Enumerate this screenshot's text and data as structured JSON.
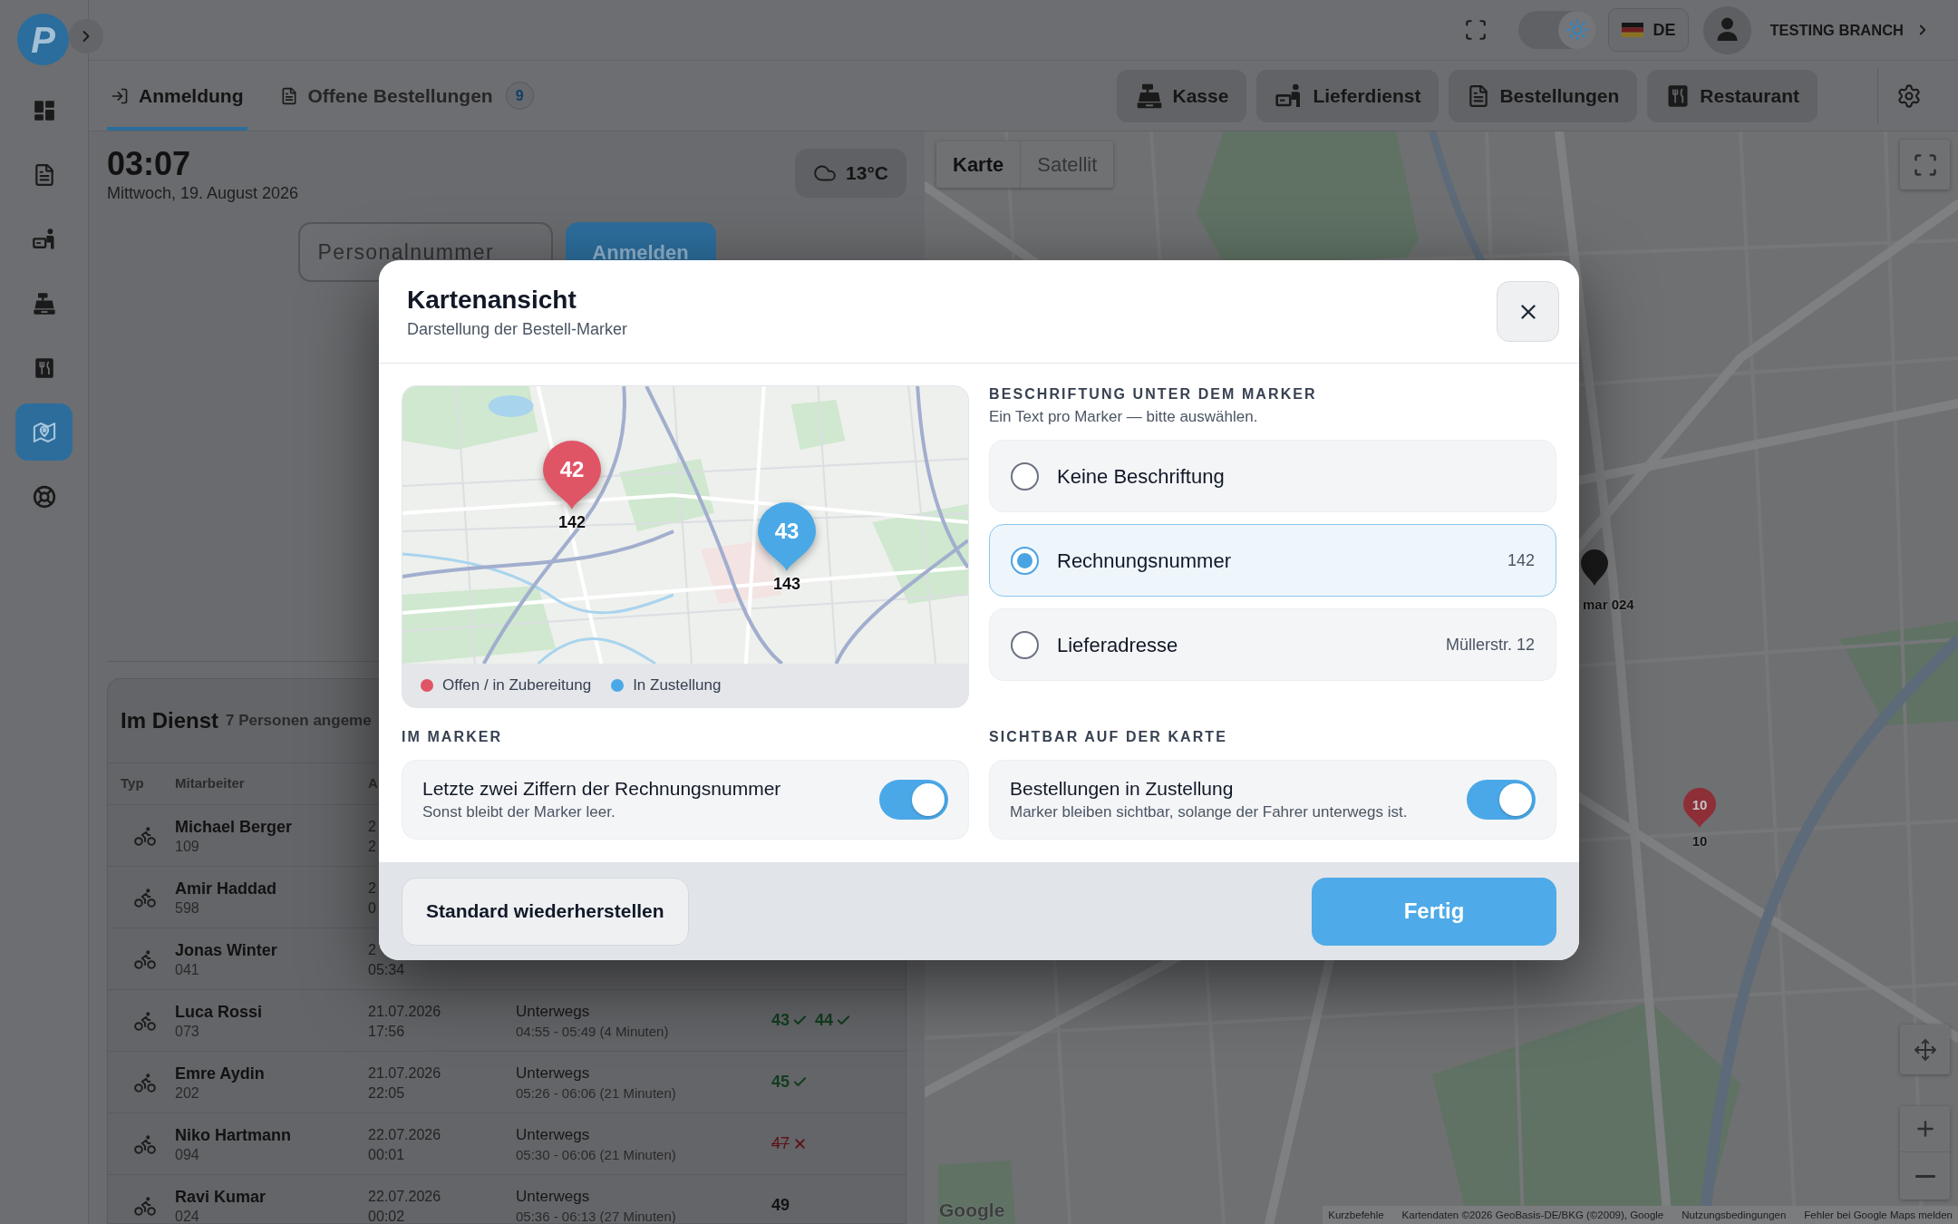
{
  "sidebar": {
    "logo": "P",
    "items": [
      {
        "kind": "dashboard",
        "selected": false
      },
      {
        "kind": "orders",
        "selected": false
      },
      {
        "kind": "delivery",
        "selected": false
      },
      {
        "kind": "cashier",
        "selected": false
      },
      {
        "kind": "restaurant",
        "selected": false
      },
      {
        "kind": "map",
        "selected": true
      },
      {
        "kind": "help",
        "selected": false
      }
    ]
  },
  "header": {
    "theme_switch": {
      "on": true
    },
    "language": "DE",
    "branch": "TESTING BRANCH"
  },
  "tabs": [
    {
      "kind": "login",
      "label": "Anmeldung",
      "selected": true
    },
    {
      "kind": "orders",
      "label": "Offene Bestellungen",
      "badge": "9",
      "selected": false
    }
  ],
  "nav_buttons": [
    {
      "kind": "cashier",
      "label": "Kasse"
    },
    {
      "kind": "delivery",
      "label": "Lieferdienst"
    },
    {
      "kind": "orders",
      "label": "Bestellungen"
    },
    {
      "kind": "restaurant",
      "label": "Restaurant"
    }
  ],
  "login": {
    "time": "03:07",
    "date": "Mittwoch, 19. August 2026",
    "weather": "13°C",
    "staff_field": {
      "placeholder": "Personalnummer"
    },
    "submit": "Anmelden"
  },
  "on_duty": {
    "title": "Im Dienst",
    "subtitle": "7 Personen angeme",
    "columns": [
      "Typ",
      "Mitarbeiter",
      "A"
    ],
    "rows": [
      {
        "name": "Michael Berger",
        "number": "109",
        "date": "2",
        "time": "2"
      },
      {
        "name": "Amir Haddad",
        "number": "598",
        "date": "2",
        "time": "0"
      },
      {
        "name": "Jonas Winter",
        "number": "041",
        "date": "2",
        "time": "05:34"
      },
      {
        "name": "Luca Rossi",
        "number": "073",
        "date": "21.07.2026",
        "time": "17:56",
        "status": "Unterwegs",
        "window": "04:55 - 05:49 (4 Minuten)",
        "orders": [
          {
            "number": "43",
            "kind": "done"
          },
          {
            "number": "44",
            "kind": "done"
          }
        ]
      },
      {
        "name": "Emre Aydin",
        "number": "202",
        "date": "21.07.2026",
        "time": "22:05",
        "status": "Unterwegs",
        "window": "05:26 - 06:06 (21 Minuten)",
        "orders": [
          {
            "number": "45",
            "kind": "done"
          }
        ]
      },
      {
        "name": "Niko Hartmann",
        "number": "094",
        "date": "22.07.2026",
        "time": "00:01",
        "status": "Unterwegs",
        "window": "05:30 - 06:06 (21 Minuten)",
        "orders": [
          {
            "number": "47",
            "kind": "cancelled"
          }
        ]
      },
      {
        "name": "Ravi Kumar",
        "number": "024",
        "date": "22.07.2026",
        "time": "00:02",
        "status": "Unterwegs",
        "window": "05:36 - 06:13 (27 Minuten)",
        "orders": [
          {
            "number": "49",
            "kind": "open"
          }
        ]
      }
    ]
  },
  "map": {
    "view_switch": [
      {
        "label": "Karte",
        "selected": true
      },
      {
        "label": "Satellit",
        "selected": false
      }
    ],
    "markers": [
      {
        "number": "10",
        "label": "10"
      }
    ],
    "driver_label": "mar 024",
    "logo": "Google",
    "attribution": [
      "Kurzbefehle",
      "Kartendaten ©2026 GeoBasis-DE/BKG (©2009), Google",
      "Nutzungsbedingungen",
      "Fehler bei Google Maps melden"
    ]
  },
  "dialog": {
    "title": "Kartenansicht",
    "subtitle": "Darstellung der Bestell-Marker",
    "preview": {
      "markers": [
        {
          "number": "42",
          "label": "142",
          "color": "#e05565"
        },
        {
          "number": "43",
          "label": "143",
          "color": "#4aa8e6"
        }
      ],
      "legend": [
        {
          "label": "Offen / in Zubereitung",
          "color": "#e05565"
        },
        {
          "label": "In Zustellung",
          "color": "#4aa8e6"
        }
      ]
    },
    "caption": {
      "heading": "BESCHRIFTUNG UNTER DEM MARKER",
      "hint": "Ein Text pro Marker — bitte auswählen.",
      "options": [
        {
          "label": "Keine Beschriftung",
          "selected": false
        },
        {
          "label": "Rechnungsnummer",
          "example": "142",
          "selected": true
        },
        {
          "label": "Lieferadresse",
          "example": "Müllerstr. 12",
          "selected": false
        }
      ]
    },
    "in_marker": {
      "heading": "IM MARKER",
      "title": "Letzte zwei Ziffern der Rechnungsnummer",
      "hint": "Sonst bleibt der Marker leer.",
      "on": true
    },
    "visibility": {
      "heading": "SICHTBAR AUF DER KARTE",
      "title": "Bestellungen in Zustellung",
      "hint": "Marker bleiben sichtbar, solange der Fahrer unterwegs ist.",
      "on": true
    },
    "buttons": {
      "reset": "Standard wiederherstellen",
      "done": "Fertig"
    }
  }
}
